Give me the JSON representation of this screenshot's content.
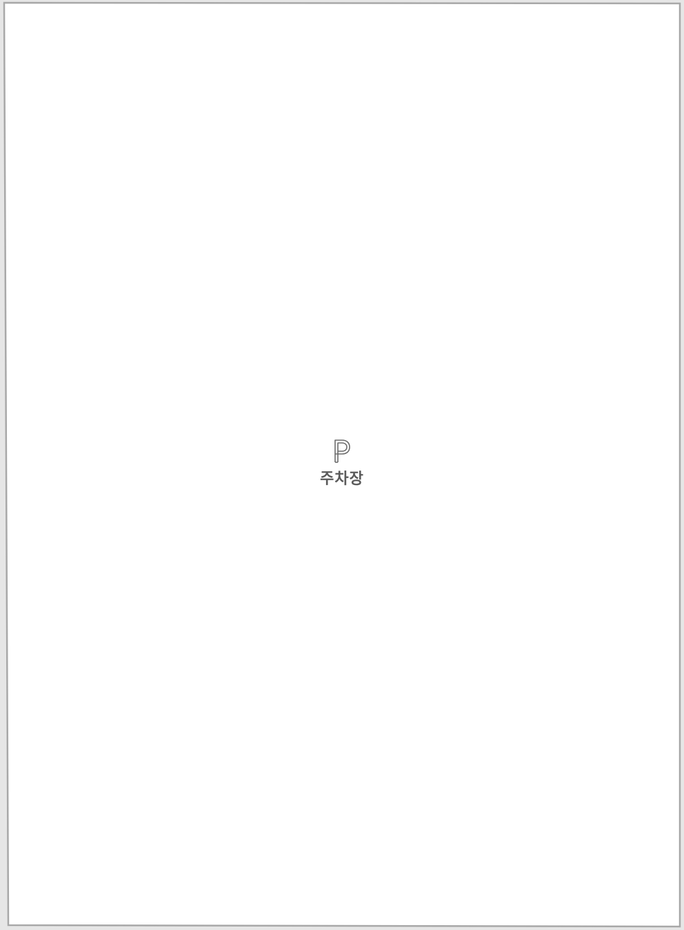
{
  "room": {
    "label": "주차장",
    "icon": "parking-icon"
  },
  "colors": {
    "background": "#e6e6e6",
    "sheet": "#ffffff",
    "frame": "#a8a8a8",
    "icon": "#6a6a6a",
    "label": "#5a5a5a"
  }
}
